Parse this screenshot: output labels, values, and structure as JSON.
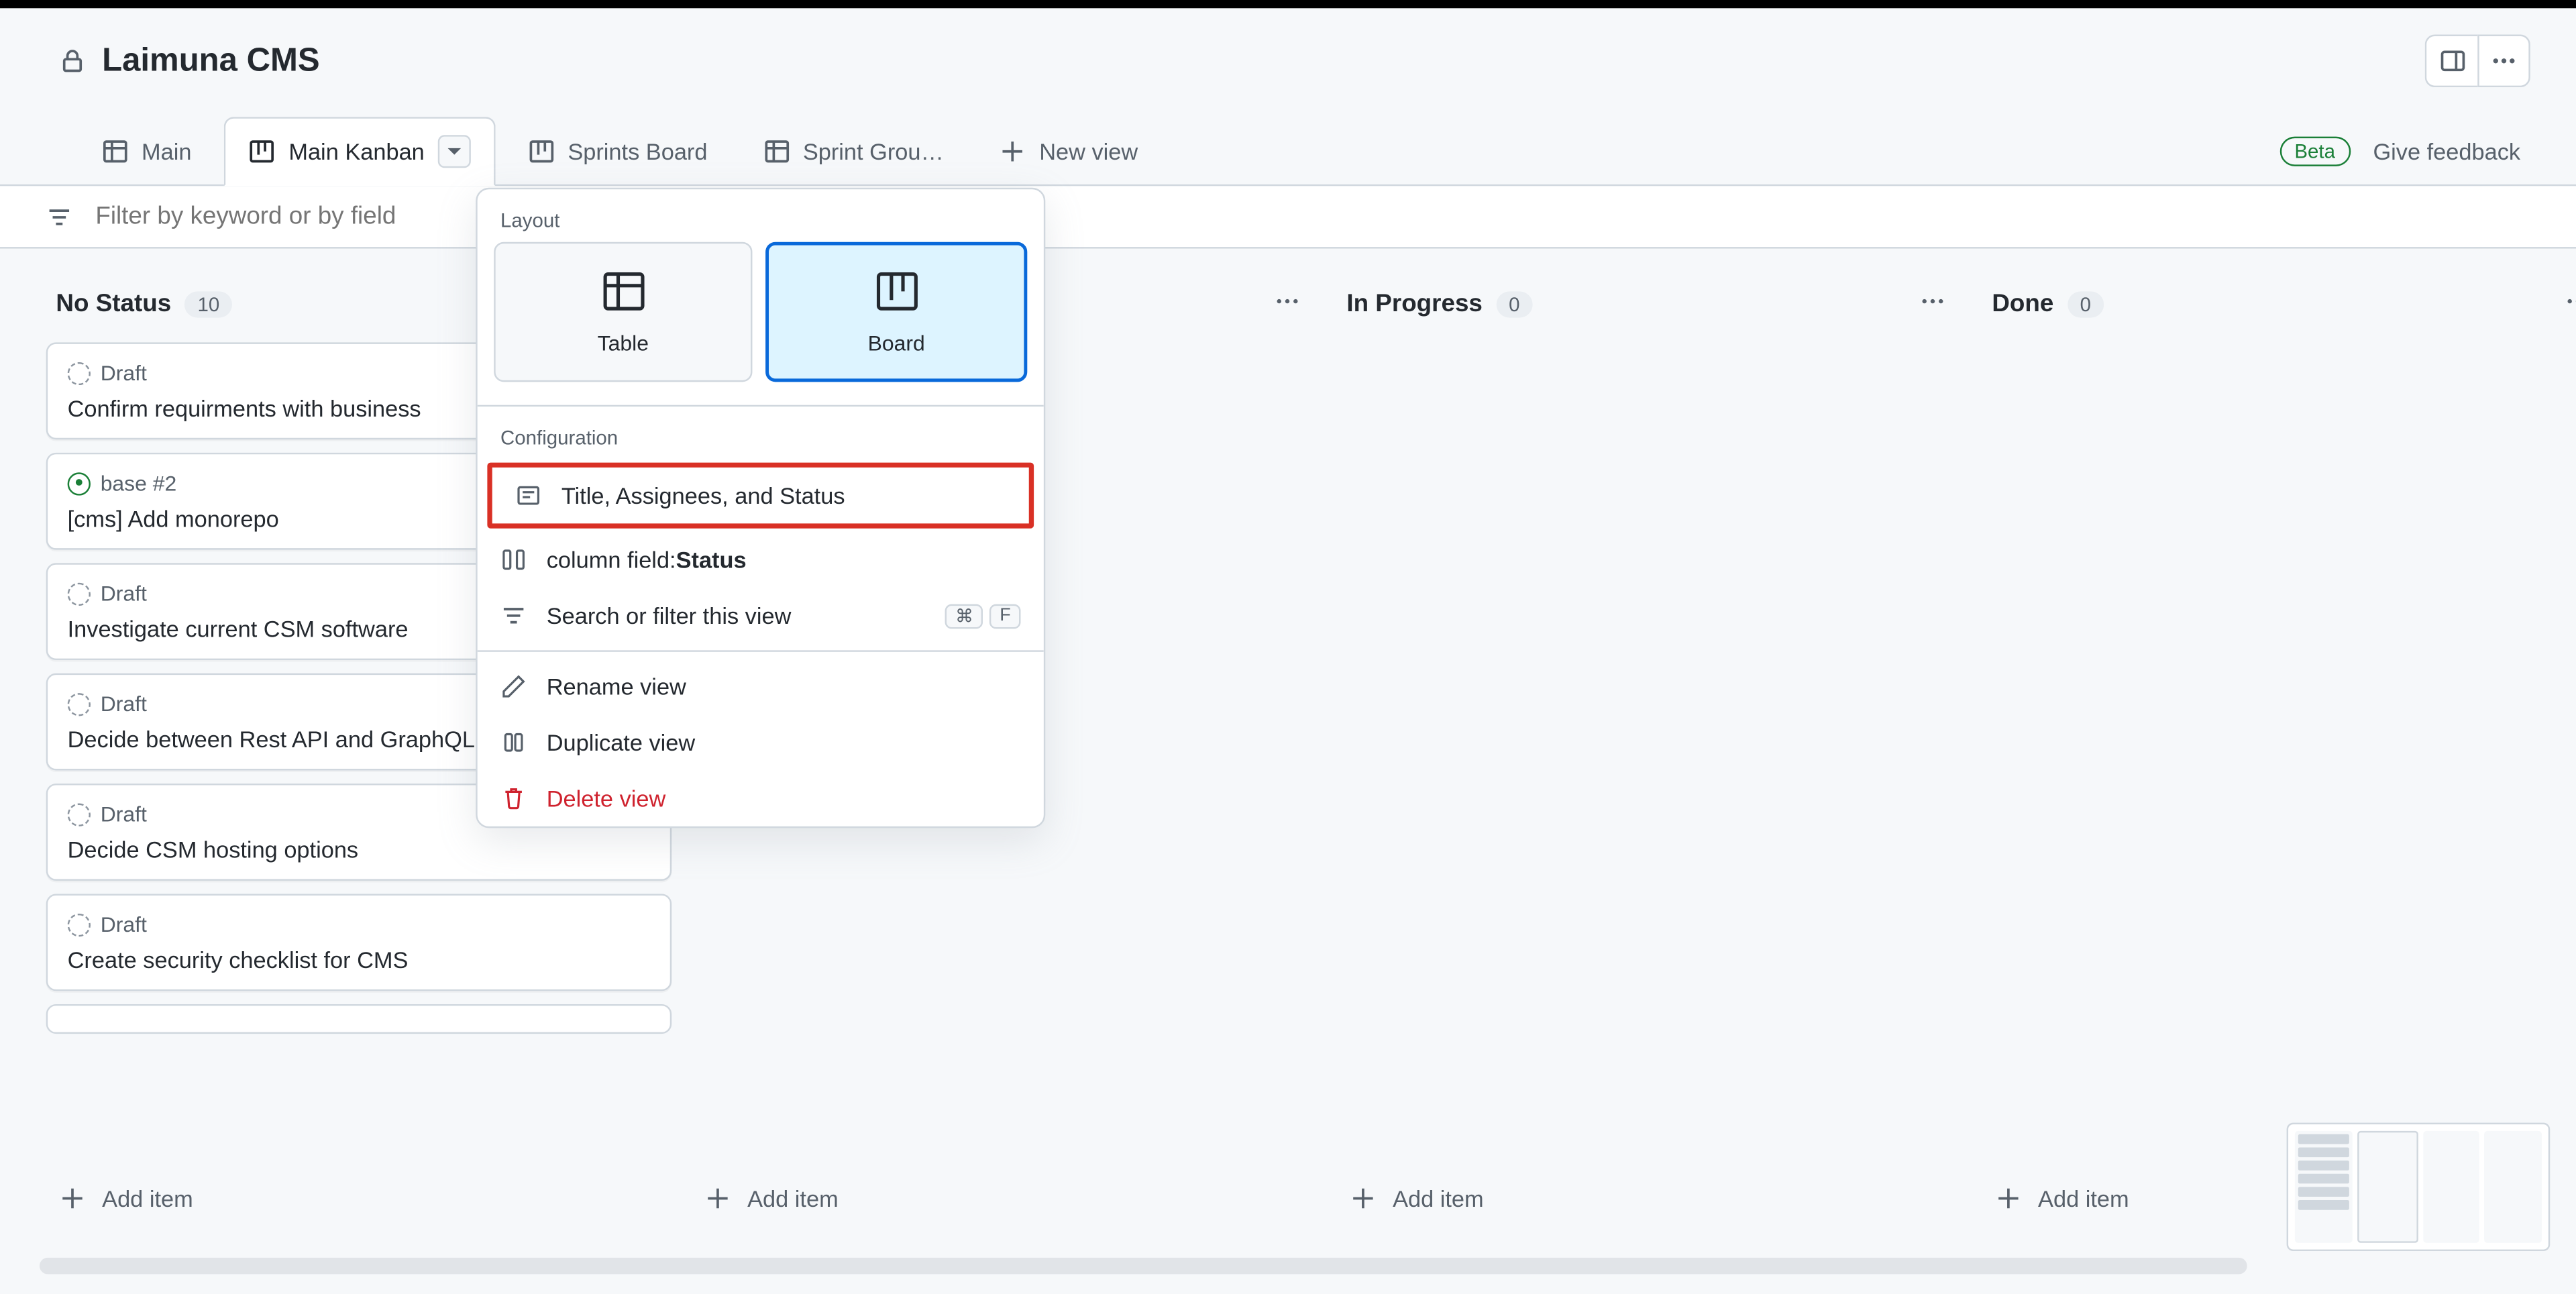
{
  "header": {
    "title": "Laimuna CMS"
  },
  "tabs": [
    {
      "label": "Main",
      "icon": "table"
    },
    {
      "label": "Main Kanban",
      "icon": "board",
      "active": true,
      "has_caret": true
    },
    {
      "label": "Sprints Board",
      "icon": "board"
    },
    {
      "label": "Sprint Grou…",
      "icon": "table"
    }
  ],
  "new_view_label": "New view",
  "beta_label": "Beta",
  "feedback_label": "Give feedback",
  "filter": {
    "placeholder": "Filter by keyword or by field"
  },
  "columns": [
    {
      "title": "No Status",
      "count": "10",
      "cards": [
        {
          "badge_type": "draft",
          "badge": "Draft",
          "title": "Confirm requirments with business"
        },
        {
          "badge_type": "issue",
          "badge": "base #2",
          "title": "[cms] Add monorepo"
        },
        {
          "badge_type": "draft",
          "badge": "Draft",
          "title": "Investigate current CSM software"
        },
        {
          "badge_type": "draft",
          "badge": "Draft",
          "title": "Decide between Rest API and GraphQL"
        },
        {
          "badge_type": "draft",
          "badge": "Draft",
          "title": "Decide CSM hosting options"
        },
        {
          "badge_type": "draft",
          "badge": "Draft",
          "title": "Create security checklist for CMS"
        }
      ]
    },
    {
      "title": "",
      "count": "",
      "cards": []
    },
    {
      "title": "In Progress",
      "count": "0",
      "cards": []
    },
    {
      "title": "Done",
      "count": "0",
      "cards": []
    }
  ],
  "add_item_label": "Add item",
  "dropdown": {
    "layout_label": "Layout",
    "layout_options": {
      "table": "Table",
      "board": "Board"
    },
    "configuration_label": "Configuration",
    "fields_item": "Title, Assignees, and Status",
    "column_field_prefix": "column field:",
    "column_field_value": "Status",
    "search_item": "Search or filter this view",
    "search_kbd1": "⌘",
    "search_kbd2": "F",
    "rename_item": "Rename view",
    "duplicate_item": "Duplicate view",
    "delete_item": "Delete view"
  }
}
